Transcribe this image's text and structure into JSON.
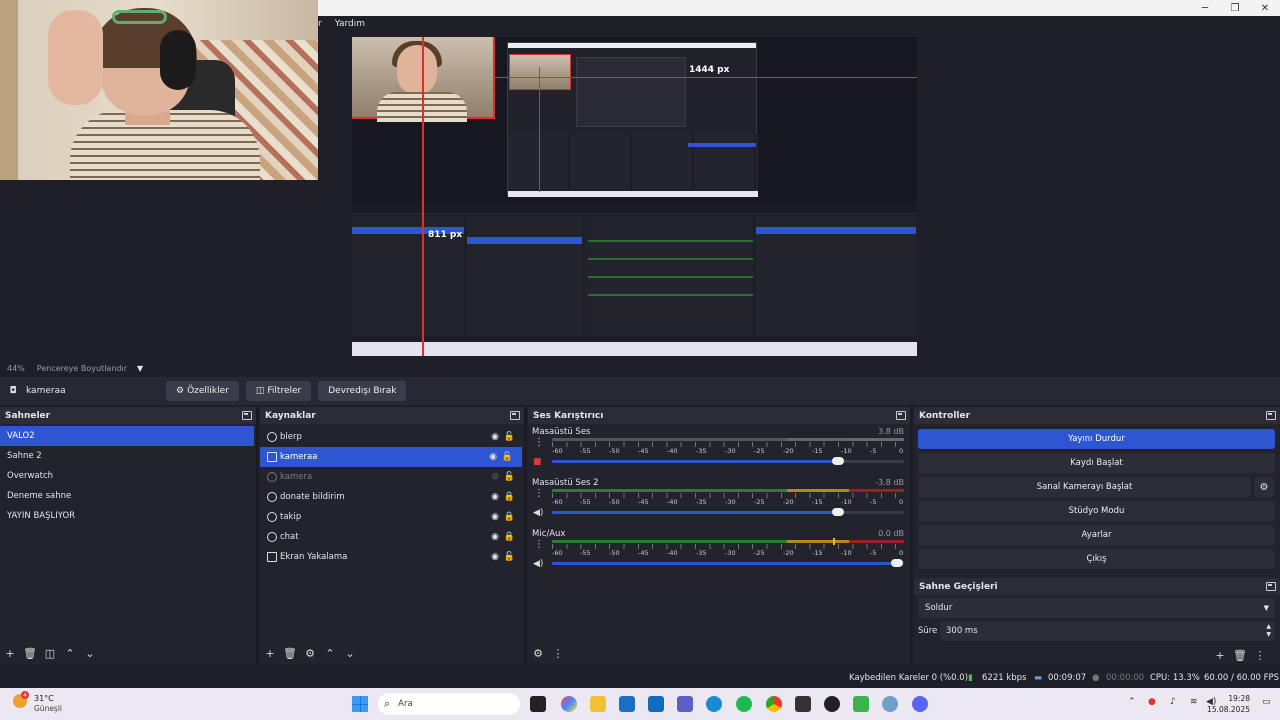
{
  "menubar": {
    "partial_item": "r",
    "help": "Yardım"
  },
  "preview": {
    "width_label": "1444 px",
    "height_label": "811 px"
  },
  "zoombar": {
    "zoom": "44%",
    "mode": "Pencereye Boyutlandır"
  },
  "source_toolbar": {
    "selected_source": "kameraa",
    "properties": "Özellikler",
    "filters": "Filtreler",
    "deactivate": "Devredışı Bırak"
  },
  "scenes": {
    "title": "Sahneler",
    "items": [
      {
        "label": "VALO2",
        "selected": true
      },
      {
        "label": "Sahne 2",
        "selected": false
      },
      {
        "label": "Overwatch",
        "selected": false
      },
      {
        "label": "Deneme sahne",
        "selected": false
      },
      {
        "label": "YAYIN BAŞLIYOR",
        "selected": false
      }
    ]
  },
  "sources": {
    "title": "Kaynaklar",
    "items": [
      {
        "label": "blerp",
        "icon": "browser-icon",
        "visible": true,
        "locked": false,
        "selected": false
      },
      {
        "label": "kameraa",
        "icon": "camera-icon",
        "visible": true,
        "locked": false,
        "selected": true
      },
      {
        "label": "kamera",
        "icon": "camera-icon",
        "visible": false,
        "locked": false,
        "selected": false
      },
      {
        "label": "donate bildirim",
        "icon": "browser-icon",
        "visible": true,
        "locked": true,
        "selected": false
      },
      {
        "label": "takip",
        "icon": "browser-icon",
        "visible": true,
        "locked": true,
        "selected": false
      },
      {
        "label": "chat",
        "icon": "browser-icon",
        "visible": true,
        "locked": true,
        "selected": false
      },
      {
        "label": "Ekran Yakalama",
        "icon": "monitor-icon",
        "visible": true,
        "locked": false,
        "selected": false
      }
    ]
  },
  "mixer": {
    "title": "Ses Karıştırıcı",
    "ticks": [
      "-60",
      "-55",
      "-50",
      "-45",
      "-40",
      "-35",
      "-30",
      "-25",
      "-20",
      "-15",
      "-10",
      "-5",
      "0"
    ],
    "channels": [
      {
        "name": "Masaüstü Ses",
        "db": "3.8 dB",
        "muted": true,
        "level": 0.0,
        "volume": 0.81
      },
      {
        "name": "Masaüstü Ses 2",
        "db": "-3.8 dB",
        "muted": false,
        "level": 1.0,
        "volume": 0.81
      },
      {
        "name": "Mic/Aux",
        "db": "0.0 dB",
        "muted": false,
        "level": 0.8,
        "volume": 0.97
      }
    ]
  },
  "controls": {
    "title": "Kontroller",
    "buttons": [
      {
        "label": "Yayını Durdur",
        "active": true
      },
      {
        "label": "Kaydı Başlat",
        "active": false
      },
      {
        "label": "Sanal Kamerayı Başlat",
        "active": false
      },
      {
        "label": "Stüdyo Modu",
        "active": false
      },
      {
        "label": "Ayarlar",
        "active": false
      },
      {
        "label": "Çıkış",
        "active": false
      }
    ]
  },
  "transitions": {
    "title": "Sahne Geçişleri",
    "selected": "Soldur",
    "duration_label": "Süre",
    "duration_value": "300 ms"
  },
  "statusbar": {
    "dropped_frames": "Kaybedilen Kareler 0 (%0.0)",
    "bitrate": "6221 kbps",
    "stream_time": "00:09:07",
    "record_time": "00:00:00",
    "cpu": "CPU: 13.3%",
    "fps": "60.00 / 60.00 FPS"
  },
  "taskbar": {
    "weather_badge": "4",
    "temperature": "31°C",
    "weather_desc": "Güneşli",
    "search_placeholder": "Ara",
    "time": "19:28",
    "date": "15.08.2025"
  }
}
